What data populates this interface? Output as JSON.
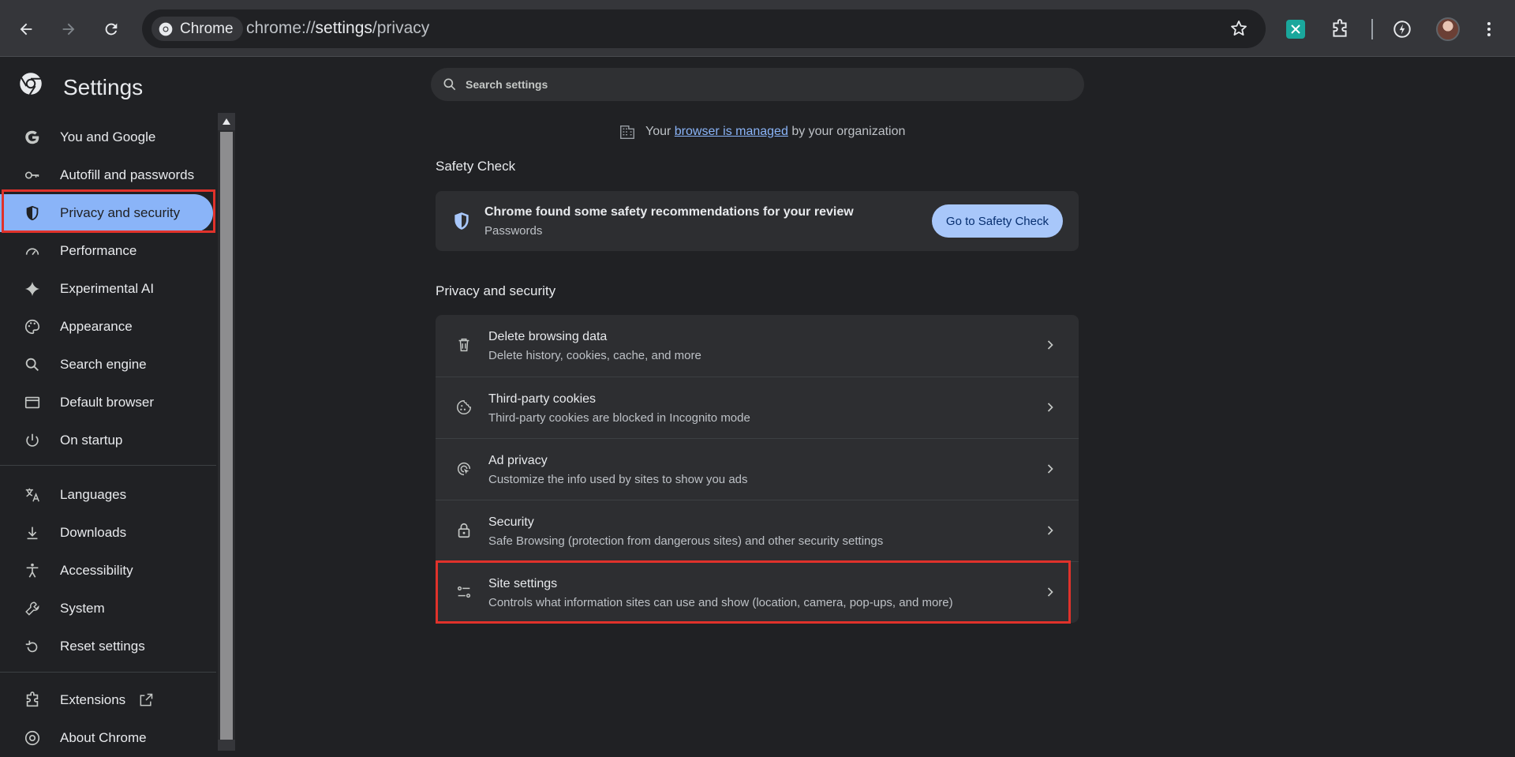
{
  "browser": {
    "chip_label": "Chrome",
    "url_prefix": "chrome://",
    "url_host": "settings",
    "url_path": "/privacy"
  },
  "settings_title": "Settings",
  "sidebar": {
    "items": [
      {
        "label": "You and Google",
        "icon": "google-icon"
      },
      {
        "label": "Autofill and passwords",
        "icon": "key-icon"
      },
      {
        "label": "Privacy and security",
        "icon": "shield-icon",
        "active": true
      },
      {
        "label": "Performance",
        "icon": "speedometer-icon"
      },
      {
        "label": "Experimental AI",
        "icon": "sparkle-icon"
      },
      {
        "label": "Appearance",
        "icon": "palette-icon"
      },
      {
        "label": "Search engine",
        "icon": "search-icon"
      },
      {
        "label": "Default browser",
        "icon": "browser-window-icon"
      },
      {
        "label": "On startup",
        "icon": "power-icon"
      },
      {
        "label": "Languages",
        "icon": "translate-icon"
      },
      {
        "label": "Downloads",
        "icon": "download-icon"
      },
      {
        "label": "Accessibility",
        "icon": "accessibility-icon"
      },
      {
        "label": "System",
        "icon": "wrench-icon"
      },
      {
        "label": "Reset settings",
        "icon": "reset-icon"
      },
      {
        "label": "Extensions",
        "icon": "puzzle-icon"
      },
      {
        "label": "About Chrome",
        "icon": "chrome-icon"
      }
    ]
  },
  "search": {
    "placeholder": "Search settings"
  },
  "managed": {
    "before": "Your",
    "link": "browser is managed",
    "after": "by your organization"
  },
  "safety_check": {
    "section_title": "Safety Check",
    "title": "Chrome found some safety recommendations for your review",
    "subtitle": "Passwords",
    "button": "Go to Safety Check"
  },
  "privacy": {
    "section_title": "Privacy and security",
    "rows": [
      {
        "title": "Delete browsing data",
        "subtitle": "Delete history, cookies, cache, and more",
        "icon": "trash-icon"
      },
      {
        "title": "Third-party cookies",
        "subtitle": "Third-party cookies are blocked in Incognito mode",
        "icon": "cookie-icon"
      },
      {
        "title": "Ad privacy",
        "subtitle": "Customize the info used by sites to show you ads",
        "icon": "ad-privacy-icon"
      },
      {
        "title": "Security",
        "subtitle": "Safe Browsing (protection from dangerous sites) and other security settings",
        "icon": "lock-icon"
      },
      {
        "title": "Site settings",
        "subtitle": "Controls what information sites can use and show (location, camera, pop-ups, and more)",
        "icon": "tune-icon"
      }
    ]
  },
  "colors": {
    "accent": "#8ab4f8",
    "highlight_frame": "#e0322b",
    "background": "#202124"
  }
}
